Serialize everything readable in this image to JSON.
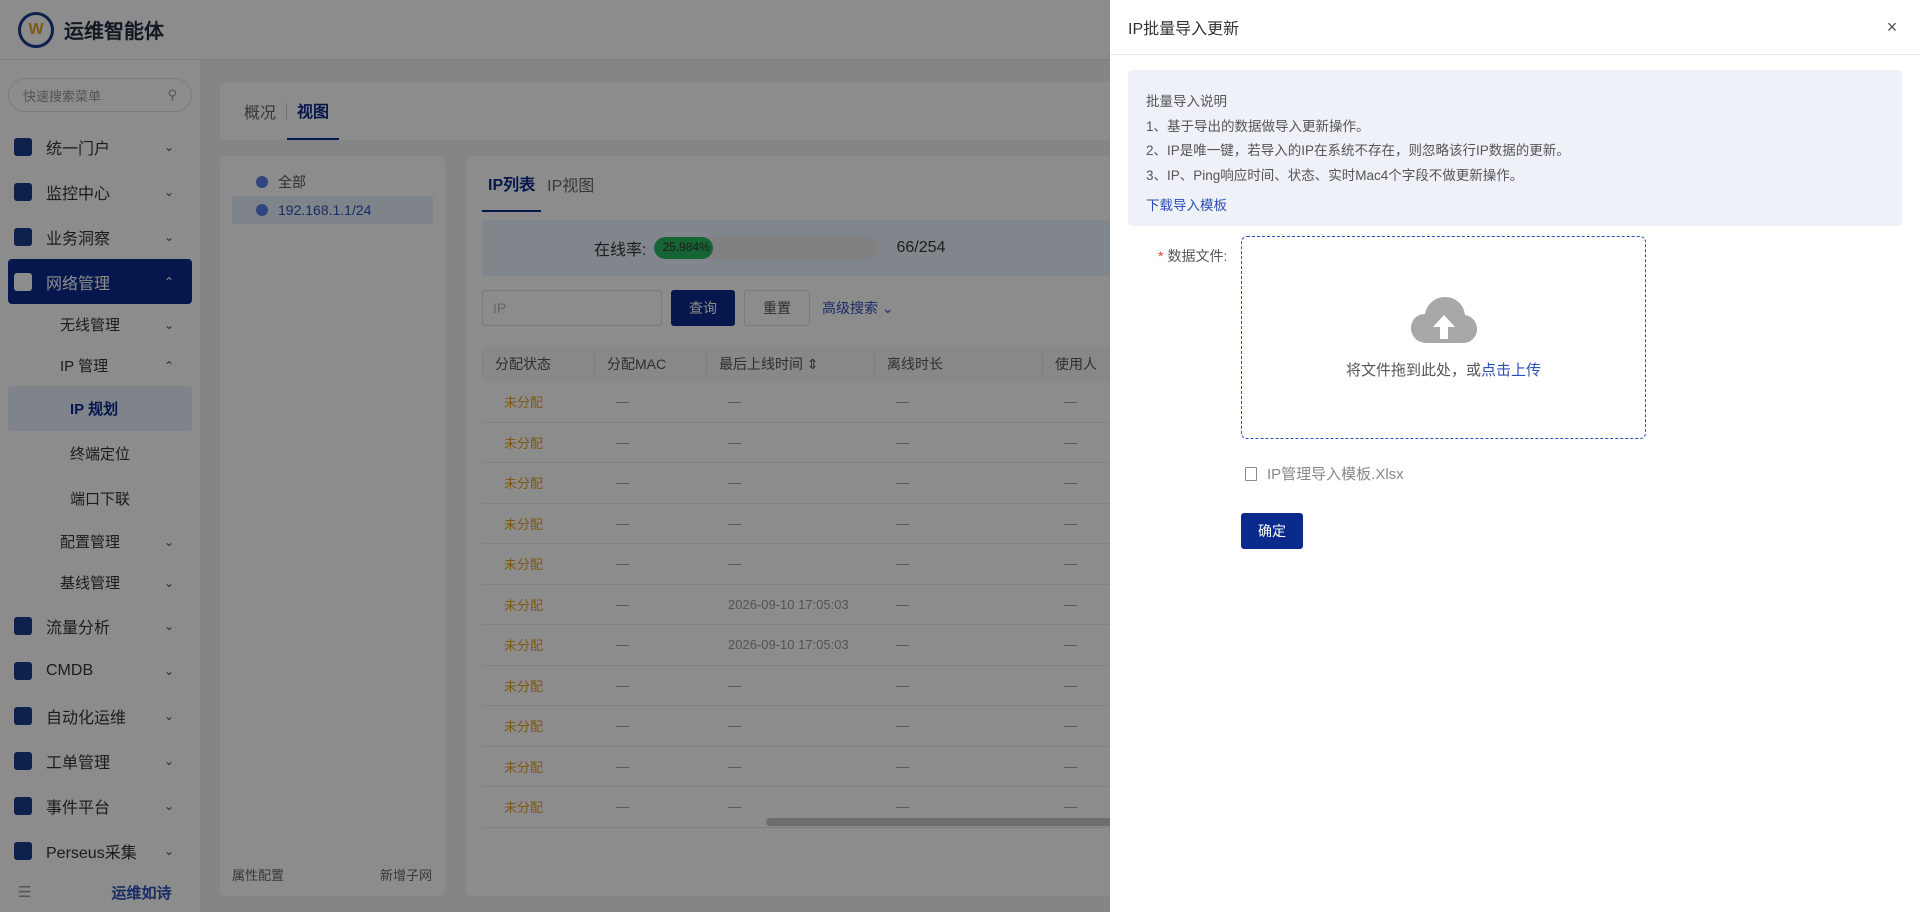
{
  "brand": {
    "logo_letter": "W",
    "name": "运维智能体"
  },
  "sidebar": {
    "search_placeholder": "快速搜索菜单",
    "menu": [
      {
        "label": "统一门户",
        "chevron": "⌄"
      },
      {
        "label": "监控中心",
        "chevron": "⌄"
      },
      {
        "label": "业务洞察",
        "chevron": "⌄"
      },
      {
        "label": "网络管理",
        "chevron": "⌃"
      }
    ],
    "network_sub": [
      {
        "label": "无线管理",
        "chevron": "⌄"
      },
      {
        "label": "IP 管理",
        "chevron": "⌃"
      }
    ],
    "ip_sub": [
      {
        "label": "IP 规划"
      },
      {
        "label": "终端定位"
      },
      {
        "label": "端口下联"
      }
    ],
    "network_sub2": [
      {
        "label": "配置管理",
        "chevron": "⌄"
      },
      {
        "label": "基线管理",
        "chevron": "⌄"
      }
    ],
    "menu2": [
      {
        "label": "流量分析",
        "chevron": "⌄"
      },
      {
        "label": "CMDB",
        "chevron": "⌄"
      },
      {
        "label": "自动化运维",
        "chevron": "⌄"
      },
      {
        "label": "工单管理",
        "chevron": "⌄"
      },
      {
        "label": "事件平台",
        "chevron": "⌄"
      },
      {
        "label": "Perseus采集",
        "chevron": "⌄"
      }
    ],
    "footer_icon": "☰",
    "footer_slogan": "运维如诗"
  },
  "page_tabs": [
    {
      "label": "概况"
    },
    {
      "label": "视图"
    }
  ],
  "tree": {
    "nodes": [
      {
        "label": "全部"
      },
      {
        "label": "192.168.1.1/24"
      }
    ],
    "footer_left": "属性配置",
    "footer_right": "新增子网"
  },
  "list": {
    "tabs": [
      {
        "label": "IP列表"
      },
      {
        "label": "IP视图"
      }
    ],
    "online_label": "在线率:",
    "online_percent_text": "25.984%",
    "online_fraction": 0.25984,
    "online_count": "66/254",
    "ip_placeholder": "IP",
    "query_label": "查询",
    "reset_label": "重置",
    "advanced_label": "高级搜索 ⌄",
    "columns": [
      "分配状态",
      "分配MAC",
      "最后上线时间 ⇕",
      "离线时长",
      "使用人"
    ],
    "rows": [
      {
        "status": "未分配",
        "mac": "—",
        "last": "—",
        "offline": "—",
        "user": "—"
      },
      {
        "status": "未分配",
        "mac": "—",
        "last": "—",
        "offline": "—",
        "user": "—"
      },
      {
        "status": "未分配",
        "mac": "—",
        "last": "—",
        "offline": "—",
        "user": "—"
      },
      {
        "status": "未分配",
        "mac": "—",
        "last": "—",
        "offline": "—",
        "user": "—"
      },
      {
        "status": "未分配",
        "mac": "—",
        "last": "—",
        "offline": "—",
        "user": "—"
      },
      {
        "status": "未分配",
        "mac": "—",
        "last": "2026-09-10 17:05:03",
        "offline": "—",
        "user": "—"
      },
      {
        "status": "未分配",
        "mac": "—",
        "last": "2026-09-10 17:05:03",
        "offline": "—",
        "user": "—"
      },
      {
        "status": "未分配",
        "mac": "—",
        "last": "—",
        "offline": "—",
        "user": "—"
      },
      {
        "status": "未分配",
        "mac": "—",
        "last": "—",
        "offline": "—",
        "user": "—"
      },
      {
        "status": "未分配",
        "mac": "—",
        "last": "—",
        "offline": "—",
        "user": "—"
      },
      {
        "status": "未分配",
        "mac": "—",
        "last": "—",
        "offline": "—",
        "user": "—"
      }
    ]
  },
  "drawer": {
    "title": "IP批量导入更新",
    "close": "×",
    "notice_title": "批量导入说明",
    "notice_lines": [
      "1、基于导出的数据做导入更新操作。",
      "2、IP是唯一键，若导入的IP在系统不存在，则忽略该行IP数据的更新。",
      "3、IP、Ping响应时间、状态、实时Mac4个字段不做更新操作。"
    ],
    "download_link": "下载导入模板",
    "field_required_mark": "*",
    "field_label": "数据文件:",
    "upload_hint": "将文件拖到此处，或",
    "upload_click": "点击上传",
    "file_name": "IP管理导入模板.Xlsx",
    "confirm": "确定"
  },
  "colors": {
    "primary": "#0a2a8c",
    "link": "#2d4fb8",
    "warning": "#e8a020",
    "success": "#29b65d",
    "overlay": "rgba(0,0,0,0.45)"
  }
}
